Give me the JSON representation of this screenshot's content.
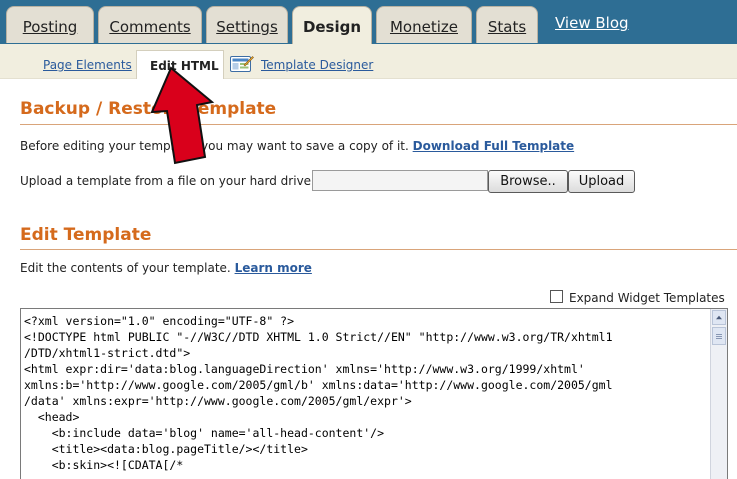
{
  "tabs": [
    {
      "label": "Posting",
      "active": false
    },
    {
      "label": "Comments",
      "active": false
    },
    {
      "label": "Settings",
      "active": false
    },
    {
      "label": "Design",
      "active": true
    },
    {
      "label": "Monetize",
      "active": false
    },
    {
      "label": "Stats",
      "active": false
    }
  ],
  "view_blog": "View Blog",
  "subtabs": {
    "page_elements": "Page Elements",
    "edit_html": "Edit HTML",
    "template_designer": "Template Designer"
  },
  "backup": {
    "heading": "Backup / Restore Template",
    "before_text": "Before editing your template, you may want to save a copy of it.",
    "download_link": "Download Full Template",
    "upload_text": "Upload a template from a file on your hard drive:",
    "browse_button": "Browse..",
    "upload_button": "Upload"
  },
  "edit": {
    "heading": "Edit Template",
    "desc": "Edit the contents of your template.",
    "learn_more": "Learn more",
    "expand_label": "Expand Widget Templates",
    "expand_checked": false,
    "code": "<?xml version=\"1.0\" encoding=\"UTF-8\" ?>\n<!DOCTYPE html PUBLIC \"-//W3C//DTD XHTML 1.0 Strict//EN\" \"http://www.w3.org/TR/xhtml1\n/DTD/xhtml1-strict.dtd\">\n<html expr:dir='data:blog.languageDirection' xmlns='http://www.w3.org/1999/xhtml'\nxmlns:b='http://www.google.com/2005/gml/b' xmlns:data='http://www.google.com/2005/gml\n/data' xmlns:expr='http://www.google.com/2005/gml/expr'>\n  <head>\n    <b:include data='blog' name='all-head-content'/>\n    <title><data:blog.pageTitle/></title>\n    <b:skin><![CDATA[/*"
  },
  "colors": {
    "top_bar": "#2e6e94",
    "heading": "#d56a1c",
    "link": "#2a5a9c",
    "arrow": "#d9001b"
  },
  "icons": {
    "template_designer": "template-designer-icon",
    "annotation": "red-arrow-icon",
    "scroll_up": "scroll-up-arrow-icon"
  }
}
